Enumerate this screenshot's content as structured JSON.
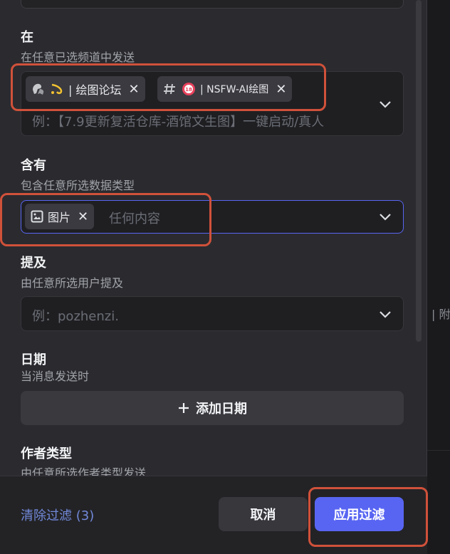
{
  "background_hint": {
    "text": "| 附"
  },
  "sections": {
    "in": {
      "title": "在",
      "subtitle": "在任意已选频道中发送",
      "chips": [
        {
          "label": "| 绘图论坛"
        },
        {
          "label": "| NSFW-AI绘图"
        }
      ],
      "placeholder": "例：【7.9更新复活仓库-酒馆文生图】一键启动/真人"
    },
    "has": {
      "title": "含有",
      "subtitle": "包含任意所选数据类型",
      "chip": {
        "label": "图片"
      },
      "placeholder": "任何内容"
    },
    "mentions": {
      "title": "提及",
      "subtitle": "由任意所选用户提及",
      "placeholder": "例：pozhenzi."
    },
    "date": {
      "title": "日期",
      "subtitle": "当消息发送时",
      "add_button": "添加日期"
    },
    "author_type": {
      "title": "作者类型",
      "subtitle": "由任意所选作者类型发送"
    }
  },
  "footer": {
    "clear_label": "清除过滤 (3)",
    "cancel_label": "取消",
    "apply_label": "应用过滤"
  },
  "colors": {
    "accent": "#5865f2",
    "annotation": "#d0513a",
    "link": "#7289da"
  },
  "icons": [
    "forum-icon",
    "sparkle-emoji-icon",
    "text-channel-icon",
    "age-18-icon",
    "remove-icon",
    "image-icon",
    "chevron-down-icon",
    "plus-icon"
  ]
}
